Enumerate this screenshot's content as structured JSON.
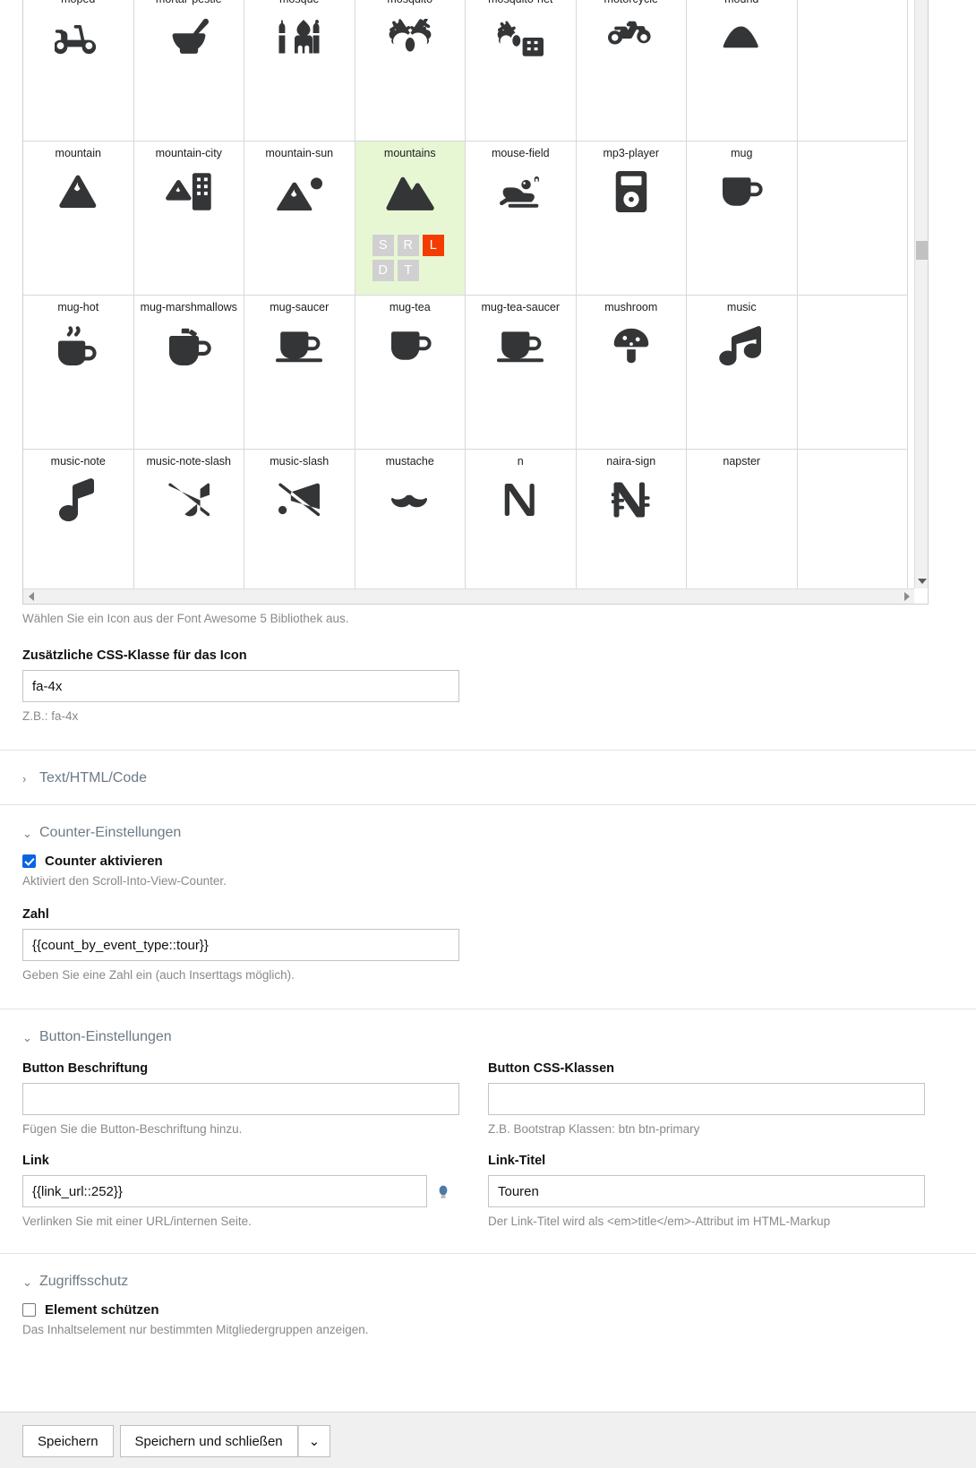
{
  "icon_picker": {
    "help_text": "Wählen Sie ein Icon aus der Font Awesome 5 Bibliothek aus.",
    "selected_icon": "mountains",
    "badges": [
      "S",
      "R",
      "L",
      "D",
      "T"
    ],
    "badge_active": "L",
    "badge_active_color": "#f43c00",
    "selected_bg_color": "#e7f7d4",
    "rows": [
      {
        "partial_top": true,
        "cells": [
          {
            "name": "",
            "glyph": ""
          },
          {
            "name": "",
            "glyph": ""
          },
          {
            "name": "",
            "glyph": ""
          },
          {
            "name": "",
            "glyph": ""
          },
          {
            "name": "",
            "glyph": ""
          },
          {
            "name": "",
            "glyph": ""
          },
          {
            "name": "",
            "glyph": ""
          },
          {
            "name": "",
            "glyph": ""
          }
        ]
      },
      {
        "cells": [
          {
            "name": "moped",
            "glyph": "moped-icon"
          },
          {
            "name": "mortar-pestle",
            "glyph": "mortar-pestle-icon"
          },
          {
            "name": "mosque",
            "glyph": "mosque-icon"
          },
          {
            "name": "mosquito",
            "glyph": "mosquito-icon"
          },
          {
            "name": "mosquito-net",
            "glyph": "mosquito-net-icon"
          },
          {
            "name": "motorcycle",
            "glyph": "motorcycle-icon"
          },
          {
            "name": "mound",
            "glyph": "mound-icon"
          },
          {
            "name": "",
            "glyph": ""
          }
        ]
      },
      {
        "cells": [
          {
            "name": "mountain",
            "glyph": "mountain-icon"
          },
          {
            "name": "mountain-city",
            "glyph": "mountain-city-icon"
          },
          {
            "name": "mountain-sun",
            "glyph": "mountain-sun-icon"
          },
          {
            "name": "mountains",
            "glyph": "mountains-icon",
            "selected": true
          },
          {
            "name": "mouse-field",
            "glyph": "mouse-field-icon"
          },
          {
            "name": "mp3-player",
            "glyph": "mp3-player-icon"
          },
          {
            "name": "mug",
            "glyph": "mug-icon"
          },
          {
            "name": "",
            "glyph": ""
          }
        ]
      },
      {
        "cells": [
          {
            "name": "mug-hot",
            "glyph": "mug-hot-icon"
          },
          {
            "name": "mug-marshmallows",
            "glyph": "mug-marshmallows-icon"
          },
          {
            "name": "mug-saucer",
            "glyph": "mug-saucer-icon"
          },
          {
            "name": "mug-tea",
            "glyph": "mug-tea-icon"
          },
          {
            "name": "mug-tea-saucer",
            "glyph": "mug-tea-saucer-icon"
          },
          {
            "name": "mushroom",
            "glyph": "mushroom-icon"
          },
          {
            "name": "music",
            "glyph": "music-icon"
          },
          {
            "name": "",
            "glyph": ""
          }
        ]
      },
      {
        "cells": [
          {
            "name": "music-note",
            "glyph": "music-note-icon"
          },
          {
            "name": "music-note-slash",
            "glyph": "music-note-slash-icon"
          },
          {
            "name": "music-slash",
            "glyph": "music-slash-icon"
          },
          {
            "name": "mustache",
            "glyph": "mustache-icon"
          },
          {
            "name": "n",
            "glyph": "letter-n-icon"
          },
          {
            "name": "naira-sign",
            "glyph": "naira-sign-icon"
          },
          {
            "name": "napster",
            "glyph": ""
          },
          {
            "name": "",
            "glyph": ""
          }
        ]
      }
    ]
  },
  "css_class_field": {
    "label": "Zusätzliche CSS-Klasse für das Icon",
    "value": "fa-4x",
    "help": "Z.B.: fa-4x"
  },
  "sections": {
    "text_html_code": {
      "title": "Text/HTML/Code",
      "expanded": false,
      "chevron": "›"
    },
    "counter": {
      "title": "Counter-Einstellungen",
      "expanded": true,
      "chevron": "⌄"
    },
    "button": {
      "title": "Button-Einstellungen",
      "expanded": true,
      "chevron": "⌄"
    },
    "access": {
      "title": "Zugriffsschutz",
      "expanded": true,
      "chevron": "⌄"
    }
  },
  "counter": {
    "checkbox_label": "Counter aktivieren",
    "checkbox_checked": true,
    "checkbox_help": "Aktiviert den Scroll-Into-View-Counter.",
    "number_label": "Zahl",
    "number_value": "{{count_by_event_type::tour}}",
    "number_help": "Geben Sie eine Zahl ein (auch Inserttags möglich)."
  },
  "button_settings": {
    "caption_label": "Button Beschriftung",
    "caption_value": "",
    "caption_help": "Fügen Sie die Button-Beschriftung hinzu.",
    "cssclasses_label": "Button CSS-Klassen",
    "cssclasses_value": "",
    "cssclasses_help": "Z.B. Bootstrap Klassen: btn btn-primary",
    "link_label": "Link",
    "link_value": "{{link_url::252}}",
    "link_help": "Verlinken Sie mit einer URL/internen Seite.",
    "linktitle_label": "Link-Titel",
    "linktitle_value": "Touren",
    "linktitle_help": "Der Link-Titel wird als <em>title</em>-Attribut im HTML-Markup"
  },
  "access_protection": {
    "checkbox_label": "Element schützen",
    "checkbox_checked": false,
    "checkbox_help": "Das Inhaltselement nur bestimmten Mitgliedergruppen anzeigen."
  },
  "footer": {
    "save_label": "Speichern",
    "save_close_label": "Speichern und schließen",
    "dropdown_caret": "⌄"
  }
}
